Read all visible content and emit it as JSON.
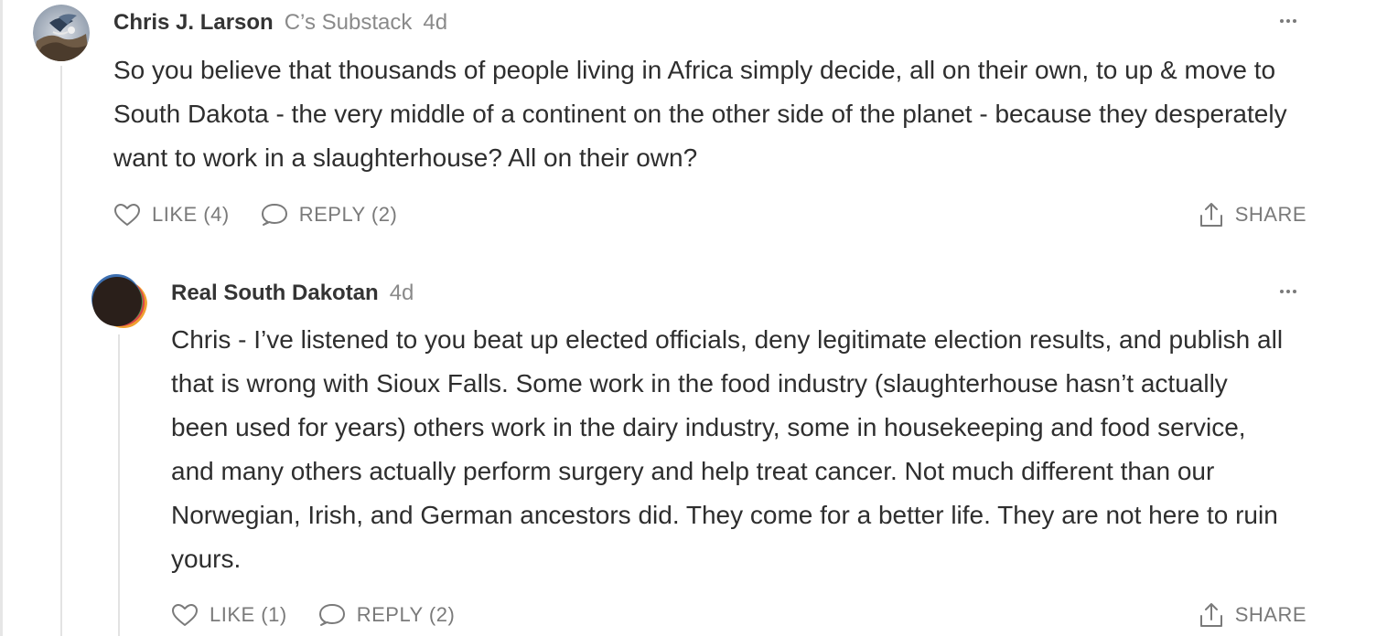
{
  "comments": [
    {
      "author": "Chris J. Larson",
      "publication": "C’s Substack",
      "age": "4d",
      "body": "So you believe that thousands of people living in Africa simply decide, all on their own, to up & move to South Dakota - the very middle of a continent on the other side of the planet - because they desperately want to work in a slaughterhouse? All on their own?",
      "like_label": "LIKE (4)",
      "reply_label": "REPLY (2)",
      "share_label": "SHARE"
    },
    {
      "author": "Real South Dakotan",
      "age": "4d",
      "body": "Chris - I’ve listened to you beat up elected officials, deny legitimate election results, and publish all that is wrong with Sioux Falls. Some work in the food industry (slaughterhouse hasn’t actually been used for years) others work in the dairy industry, some in housekeeping and food service, and many others actually perform surgery and help treat cancer. Not much different than our Norwegian, Irish, and German ancestors did. They come for a better life. They are not here to ruin yours.",
      "like_label": "LIKE (1)",
      "reply_label": "REPLY (2)",
      "share_label": "SHARE"
    }
  ],
  "icons": {
    "more": "more-options-icon",
    "like": "heart-icon",
    "reply": "speech-bubble-icon",
    "share": "share-icon"
  },
  "colors": {
    "text": "#2e2e2e",
    "muted": "#8a8a8a",
    "thread_line": "#e3e3e3"
  }
}
